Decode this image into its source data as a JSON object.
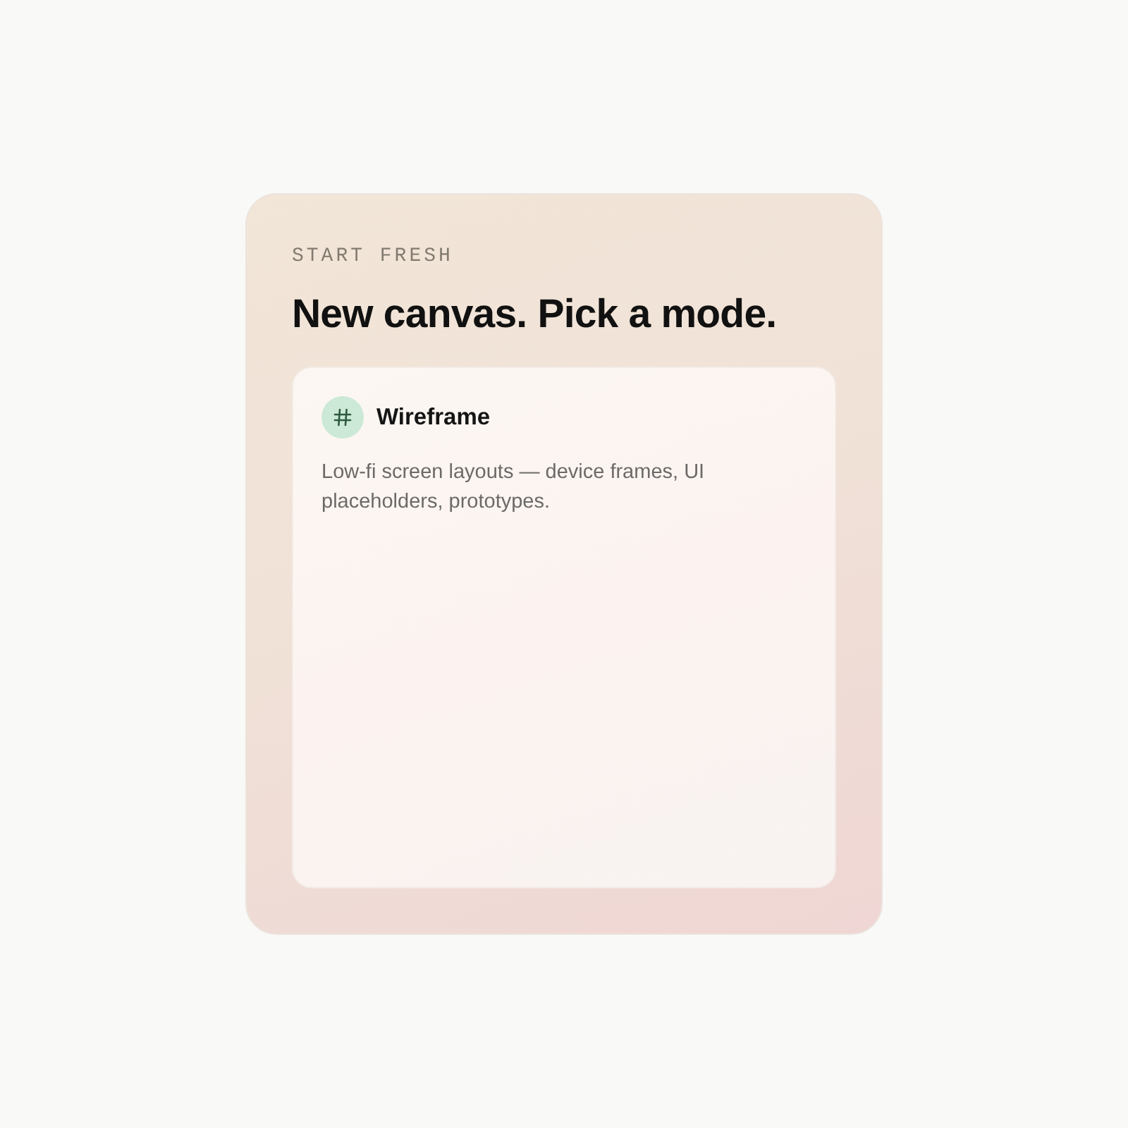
{
  "eyebrow": "START FRESH",
  "title": "New canvas. Pick a mode.",
  "modes": [
    {
      "title": "Wireframe",
      "description": "Low-fi screen layouts — device frames, UI placeholders, prototypes."
    }
  ]
}
